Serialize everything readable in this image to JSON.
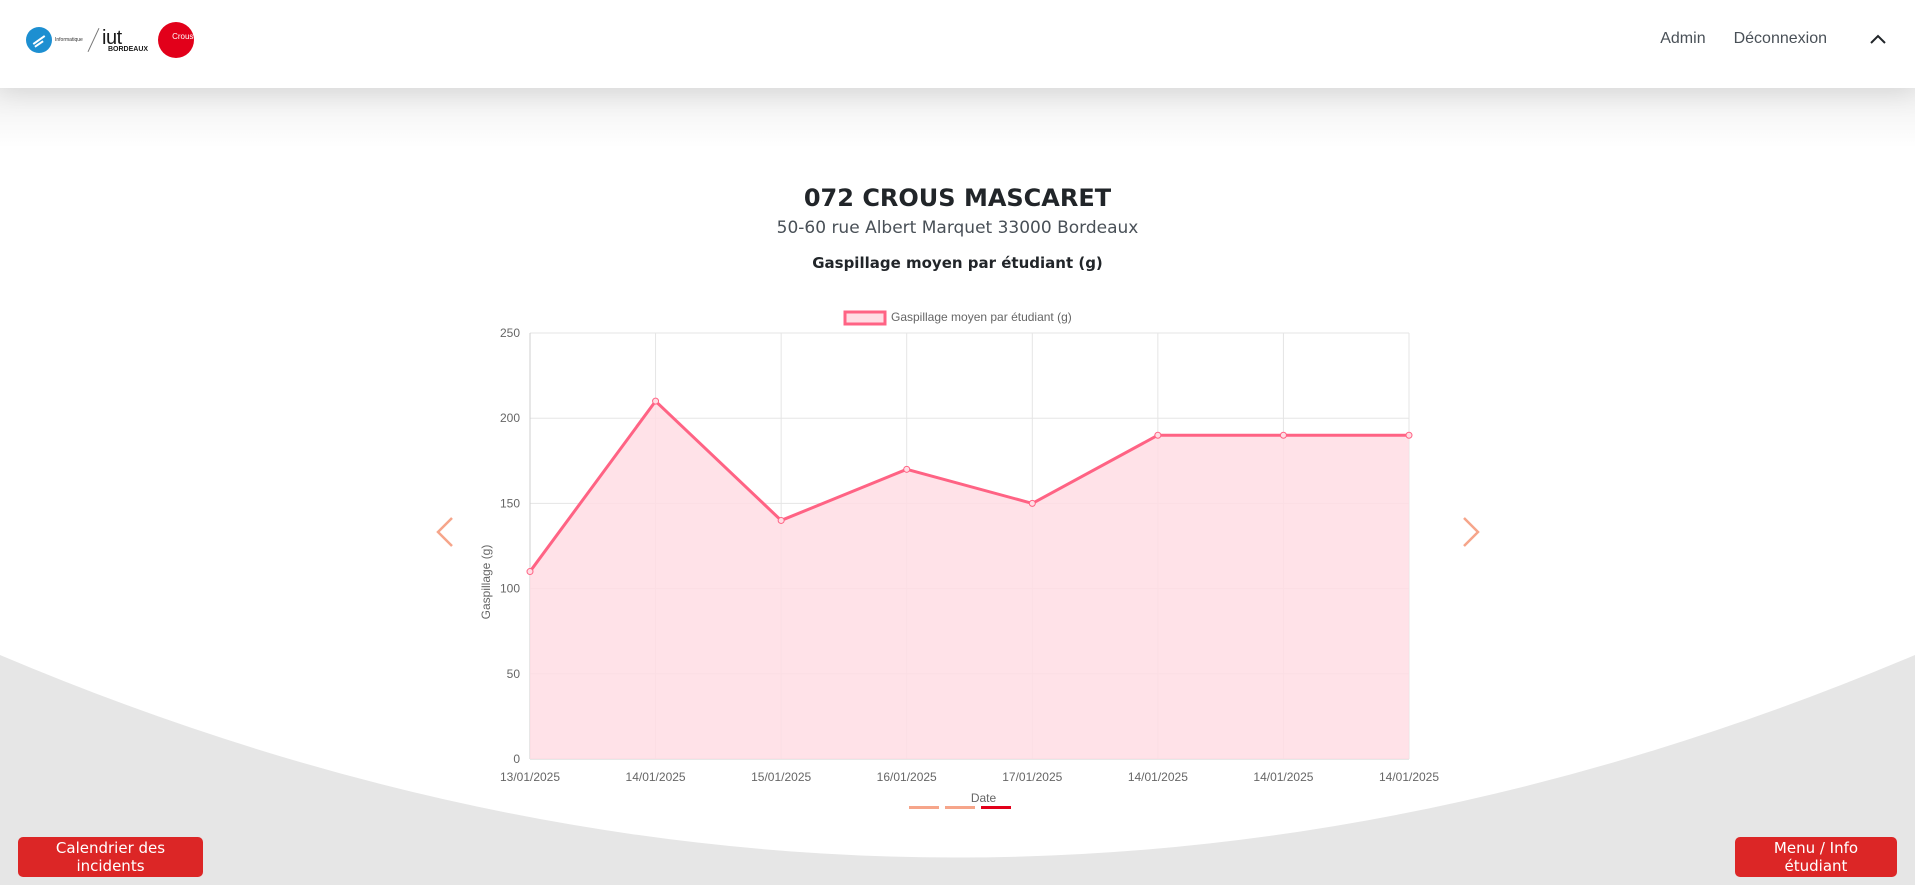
{
  "header": {
    "logo_info_text": "Informatique",
    "logo_iut_text": "iut",
    "logo_bordeaux_text": "BORDEAUX",
    "logo_crous_text": "Crous",
    "nav_links": [
      {
        "label": "Admin"
      },
      {
        "label": "Déconnexion"
      }
    ],
    "toggle_icon": "chevron-up-icon"
  },
  "restaurant": {
    "name": "072 CROUS MASCARET",
    "address": "50-60 rue Albert Marquet 33000 Bordeaux",
    "chart_heading": "Gaspillage moyen par étudiant (g)"
  },
  "chart_data": {
    "type": "area",
    "title": "",
    "legend": "Gaspillage moyen par étudiant (g)",
    "legend_position": "top",
    "xlabel": "Date",
    "ylabel": "Gaspillage (g)",
    "categories": [
      "13/01/2025",
      "14/01/2025",
      "15/01/2025",
      "16/01/2025",
      "17/01/2025",
      "14/01/2025",
      "14/01/2025",
      "14/01/2025"
    ],
    "series": [
      {
        "name": "Gaspillage moyen par étudiant (g)",
        "values": [
          110,
          210,
          140,
          170,
          150,
          190,
          190,
          190
        ]
      }
    ],
    "ylim": [
      0,
      250
    ],
    "yticks": [
      0,
      50,
      100,
      150,
      200,
      250
    ],
    "grid": true,
    "line_color": "#ff6384",
    "fill_color": "#ffdde4"
  },
  "carousel": {
    "prev_icon": "chevron-left-icon",
    "next_icon": "chevron-right-icon",
    "indicators": 3,
    "active_index": 2
  },
  "buttons": {
    "calendar_label": "Calendrier des incidents",
    "menu_label": "Menu / Info étudiant"
  },
  "colors": {
    "accent_red": "#dc2626",
    "crous_red": "#e2001a",
    "carousel_arrow": "#f6a58a",
    "background_curve": "#e6e6e6"
  }
}
